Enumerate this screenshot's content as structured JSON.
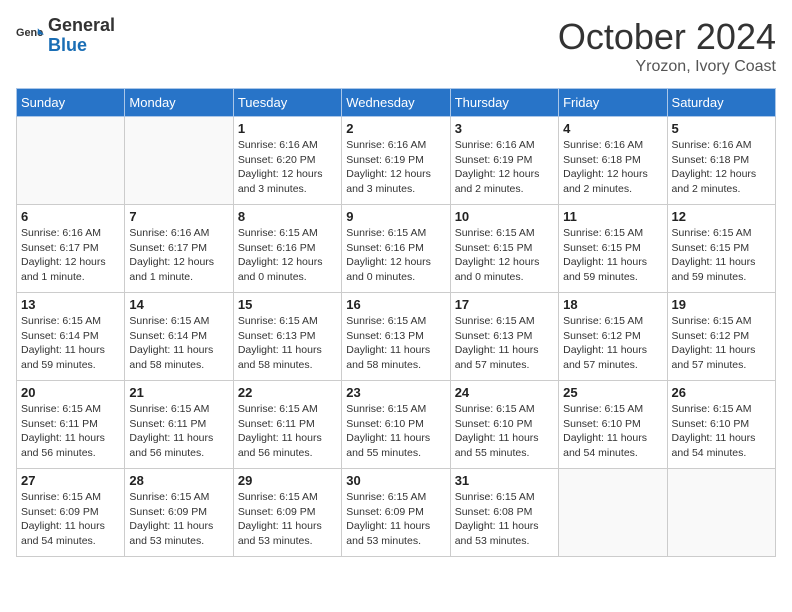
{
  "header": {
    "logo_general": "General",
    "logo_blue": "Blue",
    "month": "October 2024",
    "location": "Yrozon, Ivory Coast"
  },
  "weekdays": [
    "Sunday",
    "Monday",
    "Tuesday",
    "Wednesday",
    "Thursday",
    "Friday",
    "Saturday"
  ],
  "weeks": [
    [
      {
        "day": "",
        "detail": ""
      },
      {
        "day": "",
        "detail": ""
      },
      {
        "day": "1",
        "detail": "Sunrise: 6:16 AM\nSunset: 6:20 PM\nDaylight: 12 hours and 3 minutes."
      },
      {
        "day": "2",
        "detail": "Sunrise: 6:16 AM\nSunset: 6:19 PM\nDaylight: 12 hours and 3 minutes."
      },
      {
        "day": "3",
        "detail": "Sunrise: 6:16 AM\nSunset: 6:19 PM\nDaylight: 12 hours and 2 minutes."
      },
      {
        "day": "4",
        "detail": "Sunrise: 6:16 AM\nSunset: 6:18 PM\nDaylight: 12 hours and 2 minutes."
      },
      {
        "day": "5",
        "detail": "Sunrise: 6:16 AM\nSunset: 6:18 PM\nDaylight: 12 hours and 2 minutes."
      }
    ],
    [
      {
        "day": "6",
        "detail": "Sunrise: 6:16 AM\nSunset: 6:17 PM\nDaylight: 12 hours and 1 minute."
      },
      {
        "day": "7",
        "detail": "Sunrise: 6:16 AM\nSunset: 6:17 PM\nDaylight: 12 hours and 1 minute."
      },
      {
        "day": "8",
        "detail": "Sunrise: 6:15 AM\nSunset: 6:16 PM\nDaylight: 12 hours and 0 minutes."
      },
      {
        "day": "9",
        "detail": "Sunrise: 6:15 AM\nSunset: 6:16 PM\nDaylight: 12 hours and 0 minutes."
      },
      {
        "day": "10",
        "detail": "Sunrise: 6:15 AM\nSunset: 6:15 PM\nDaylight: 12 hours and 0 minutes."
      },
      {
        "day": "11",
        "detail": "Sunrise: 6:15 AM\nSunset: 6:15 PM\nDaylight: 11 hours and 59 minutes."
      },
      {
        "day": "12",
        "detail": "Sunrise: 6:15 AM\nSunset: 6:15 PM\nDaylight: 11 hours and 59 minutes."
      }
    ],
    [
      {
        "day": "13",
        "detail": "Sunrise: 6:15 AM\nSunset: 6:14 PM\nDaylight: 11 hours and 59 minutes."
      },
      {
        "day": "14",
        "detail": "Sunrise: 6:15 AM\nSunset: 6:14 PM\nDaylight: 11 hours and 58 minutes."
      },
      {
        "day": "15",
        "detail": "Sunrise: 6:15 AM\nSunset: 6:13 PM\nDaylight: 11 hours and 58 minutes."
      },
      {
        "day": "16",
        "detail": "Sunrise: 6:15 AM\nSunset: 6:13 PM\nDaylight: 11 hours and 58 minutes."
      },
      {
        "day": "17",
        "detail": "Sunrise: 6:15 AM\nSunset: 6:13 PM\nDaylight: 11 hours and 57 minutes."
      },
      {
        "day": "18",
        "detail": "Sunrise: 6:15 AM\nSunset: 6:12 PM\nDaylight: 11 hours and 57 minutes."
      },
      {
        "day": "19",
        "detail": "Sunrise: 6:15 AM\nSunset: 6:12 PM\nDaylight: 11 hours and 57 minutes."
      }
    ],
    [
      {
        "day": "20",
        "detail": "Sunrise: 6:15 AM\nSunset: 6:11 PM\nDaylight: 11 hours and 56 minutes."
      },
      {
        "day": "21",
        "detail": "Sunrise: 6:15 AM\nSunset: 6:11 PM\nDaylight: 11 hours and 56 minutes."
      },
      {
        "day": "22",
        "detail": "Sunrise: 6:15 AM\nSunset: 6:11 PM\nDaylight: 11 hours and 56 minutes."
      },
      {
        "day": "23",
        "detail": "Sunrise: 6:15 AM\nSunset: 6:10 PM\nDaylight: 11 hours and 55 minutes."
      },
      {
        "day": "24",
        "detail": "Sunrise: 6:15 AM\nSunset: 6:10 PM\nDaylight: 11 hours and 55 minutes."
      },
      {
        "day": "25",
        "detail": "Sunrise: 6:15 AM\nSunset: 6:10 PM\nDaylight: 11 hours and 54 minutes."
      },
      {
        "day": "26",
        "detail": "Sunrise: 6:15 AM\nSunset: 6:10 PM\nDaylight: 11 hours and 54 minutes."
      }
    ],
    [
      {
        "day": "27",
        "detail": "Sunrise: 6:15 AM\nSunset: 6:09 PM\nDaylight: 11 hours and 54 minutes."
      },
      {
        "day": "28",
        "detail": "Sunrise: 6:15 AM\nSunset: 6:09 PM\nDaylight: 11 hours and 53 minutes."
      },
      {
        "day": "29",
        "detail": "Sunrise: 6:15 AM\nSunset: 6:09 PM\nDaylight: 11 hours and 53 minutes."
      },
      {
        "day": "30",
        "detail": "Sunrise: 6:15 AM\nSunset: 6:09 PM\nDaylight: 11 hours and 53 minutes."
      },
      {
        "day": "31",
        "detail": "Sunrise: 6:15 AM\nSunset: 6:08 PM\nDaylight: 11 hours and 53 minutes."
      },
      {
        "day": "",
        "detail": ""
      },
      {
        "day": "",
        "detail": ""
      }
    ]
  ]
}
